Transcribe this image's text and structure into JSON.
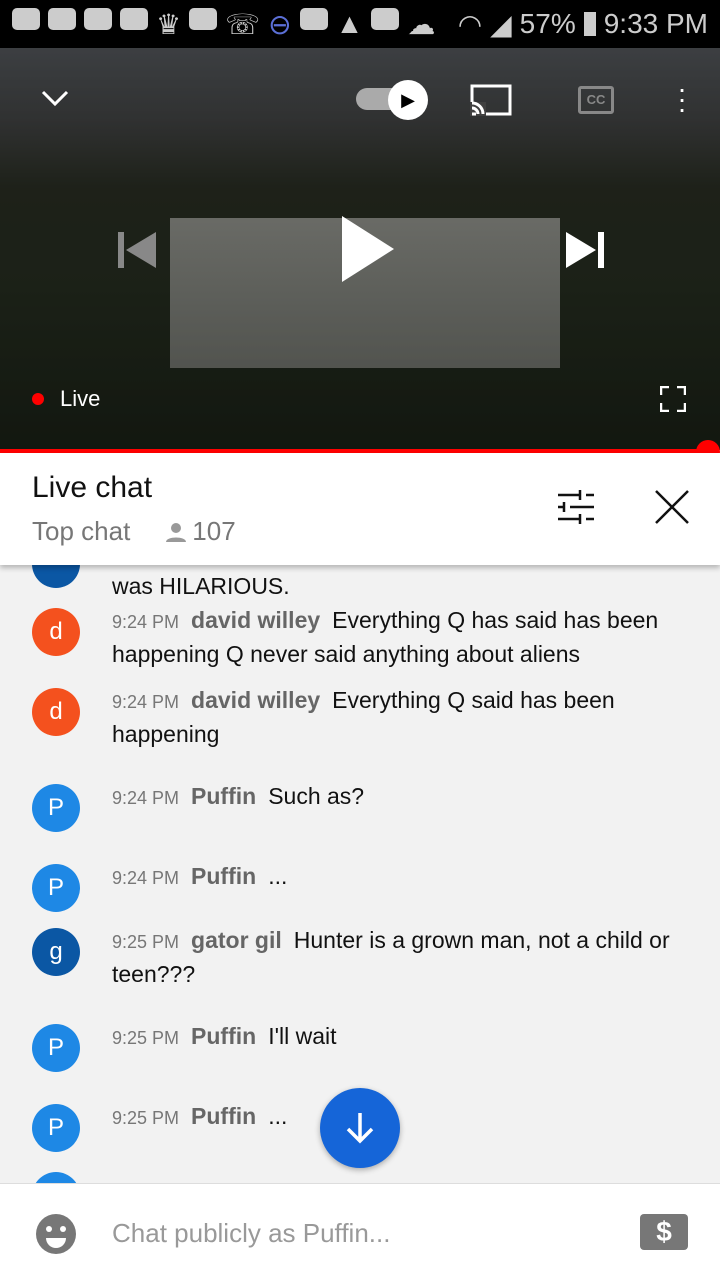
{
  "status_bar": {
    "battery": "57%",
    "time": "9:33 PM"
  },
  "player": {
    "live_label": "Live",
    "progress_percent": 100
  },
  "chat_header": {
    "title": "Live chat",
    "mode": "Top chat",
    "viewer_count": "107"
  },
  "partial_message": "was HILARIOUS.",
  "messages": [
    {
      "initial": "d",
      "color": "#f4511e",
      "time": "9:24 PM",
      "author": "david willey",
      "text": "Everything Q has said has been happening Q never said anything about aliens"
    },
    {
      "initial": "d",
      "color": "#f4511e",
      "time": "9:24 PM",
      "author": "david willey",
      "text": "Everything Q said has been happening"
    },
    {
      "initial": "P",
      "color": "#1e88e5",
      "time": "9:24 PM",
      "author": "Puffin",
      "text": "Such as?"
    },
    {
      "initial": "P",
      "color": "#1e88e5",
      "time": "9:24 PM",
      "author": "Puffin",
      "text": "..."
    },
    {
      "initial": "g",
      "color": "#0b57a4",
      "time": "9:25 PM",
      "author": "gator gil",
      "text": "Hunter is a grown man, not a child or teen???"
    },
    {
      "initial": "P",
      "color": "#1e88e5",
      "time": "9:25 PM",
      "author": "Puffin",
      "text": "I'll wait"
    },
    {
      "initial": "P",
      "color": "#1e88e5",
      "time": "9:25 PM",
      "author": "Puffin",
      "text": "..."
    }
  ],
  "input": {
    "placeholder": "Chat publicly as Puffin..."
  },
  "colors": {
    "accent_red": "#ff0000",
    "scroll_button": "#1565d8"
  }
}
